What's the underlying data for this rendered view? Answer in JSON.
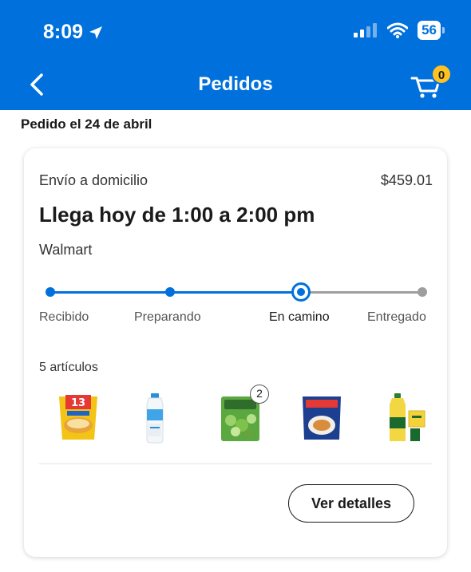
{
  "status_bar": {
    "time": "8:09",
    "battery": "56"
  },
  "header": {
    "title": "Pedidos",
    "cart_count": "0"
  },
  "order": {
    "date_label": "Pedido el 24 de abril",
    "shipping_type": "Envío a domicilio",
    "total": "$459.01",
    "eta": "Llega hoy de 1:00 a 2:00 pm",
    "store": "Walmart",
    "progress_steps": [
      {
        "label": "Recibido",
        "state": "done"
      },
      {
        "label": "Preparando",
        "state": "done"
      },
      {
        "label": "En camino",
        "state": "current"
      },
      {
        "label": "Entregado",
        "state": "pending"
      }
    ],
    "items_count_label": "5 artículos",
    "items": [
      {
        "icon": "snack-bag-icon",
        "quantity": null
      },
      {
        "icon": "milk-bottle-icon",
        "quantity": null
      },
      {
        "icon": "salad-bag-icon",
        "quantity": "2"
      },
      {
        "icon": "frozen-food-bag-icon",
        "quantity": null
      },
      {
        "icon": "oil-bottle-icon",
        "quantity": null
      }
    ],
    "details_button": "Ver detalles"
  },
  "colors": {
    "brand_blue": "#0071dc",
    "cart_badge": "#ffc220",
    "track_pending": "#9e9e9e"
  }
}
